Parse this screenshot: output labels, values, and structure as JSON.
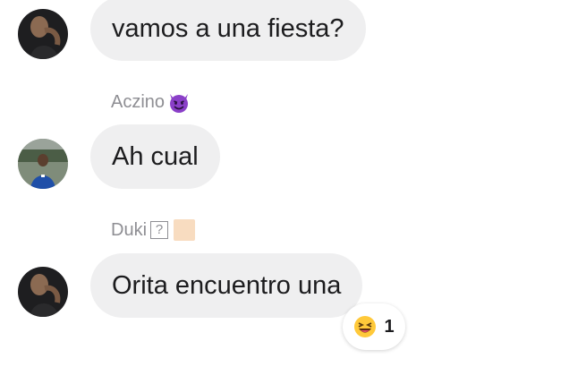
{
  "messages": [
    {
      "sender": "",
      "text": "vamos a una fiesta?",
      "avatar": "avatar-person-dark-shirt"
    },
    {
      "sender": "Aczino",
      "sender_emoji": "smiling-devil-icon",
      "text": "Ah cual",
      "avatar": "avatar-person-outdoors"
    },
    {
      "sender": "Duki",
      "sender_emoji": "unknown-glyph-icon",
      "text": "Orita encuentro una",
      "avatar": "avatar-person-dark-shirt",
      "reaction": {
        "emoji": "grinning-squinting-face-icon",
        "count": "1"
      }
    }
  ],
  "colors": {
    "bubble": "#efeff0",
    "text": "#1c1c1e",
    "sender": "#8e8e93",
    "devil": "#8a3fc8"
  }
}
